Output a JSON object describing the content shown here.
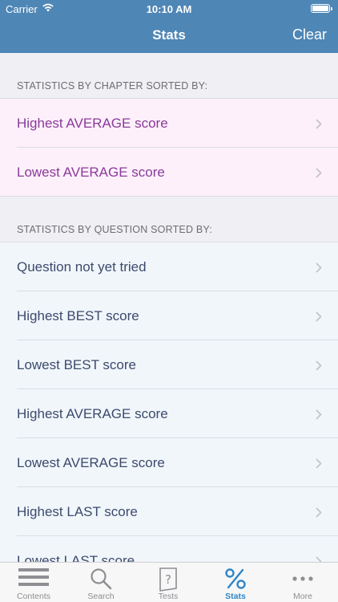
{
  "status_bar": {
    "carrier": "Carrier",
    "time": "10:10 AM"
  },
  "nav": {
    "title": "Stats",
    "clear_label": "Clear"
  },
  "chapter_section": {
    "header": "STATISTICS BY CHAPTER SORTED BY:",
    "items": [
      {
        "label": "Highest AVERAGE score"
      },
      {
        "label": "Lowest AVERAGE score"
      }
    ]
  },
  "question_section": {
    "header": "STATISTICS BY QUESTION SORTED BY:",
    "items": [
      {
        "label": "Question not yet tried"
      },
      {
        "label": "Highest BEST score"
      },
      {
        "label": "Lowest BEST score"
      },
      {
        "label": "Highest AVERAGE score"
      },
      {
        "label": "Lowest AVERAGE score"
      },
      {
        "label": "Highest LAST score"
      },
      {
        "label": "Lowest LAST score"
      }
    ]
  },
  "tabbar": {
    "tabs": [
      {
        "label": "Contents",
        "icon": "list-icon"
      },
      {
        "label": "Search",
        "icon": "search-icon"
      },
      {
        "label": "Tests",
        "icon": "question-page-icon"
      },
      {
        "label": "Stats",
        "icon": "percent-icon",
        "active": true
      },
      {
        "label": "More",
        "icon": "more-dots-icon"
      }
    ],
    "active_color": "#2f86c8",
    "inactive_color": "#8e8e93"
  },
  "colors": {
    "header_bg": "#4e86b6",
    "chapter_row_bg": "#fdf0fa",
    "chapter_text": "#8a3a9b",
    "question_row_bg": "#f1f6fb",
    "question_text": "#3c4a6c"
  }
}
